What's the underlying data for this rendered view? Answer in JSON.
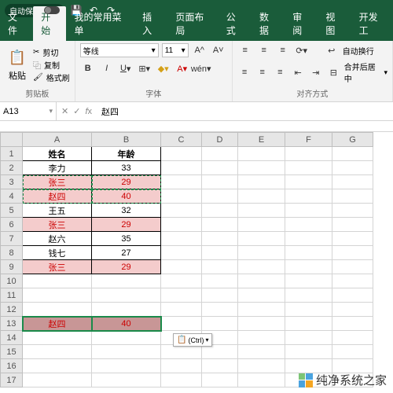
{
  "titlebar": {
    "autosave": "自动保存"
  },
  "tabs": {
    "file": "文件",
    "home": "开始",
    "custom": "我的常用菜单",
    "insert": "插入",
    "layout": "页面布局",
    "formula": "公式",
    "data": "数据",
    "review": "审阅",
    "view": "视图",
    "dev": "开发工"
  },
  "ribbon": {
    "clipboard": {
      "label": "剪贴板",
      "paste": "粘贴",
      "cut": "剪切",
      "copy": "复制",
      "painter": "格式刷"
    },
    "font": {
      "label": "字体",
      "name": "等线",
      "size": "11"
    },
    "align": {
      "label": "对齐方式",
      "wrap": "自动换行",
      "merge": "合并后居中"
    }
  },
  "namebox": {
    "ref": "A13",
    "value": "赵四"
  },
  "grid": {
    "cols": [
      "A",
      "B",
      "C",
      "D",
      "E",
      "F",
      "G"
    ],
    "headers": [
      "姓名",
      "年龄"
    ],
    "rows": [
      {
        "n": "李力",
        "a": "33",
        "pink": false
      },
      {
        "n": "张三",
        "a": "29",
        "pink": true,
        "dash": true
      },
      {
        "n": "赵四",
        "a": "40",
        "pink": true,
        "dash": true
      },
      {
        "n": "王五",
        "a": "32",
        "pink": false
      },
      {
        "n": "张三",
        "a": "29",
        "pink": true
      },
      {
        "n": "赵六",
        "a": "35",
        "pink": false
      },
      {
        "n": "钱七",
        "a": "27",
        "pink": false
      },
      {
        "n": "张三",
        "a": "29",
        "pink": true
      }
    ],
    "pasted": {
      "row": 13,
      "n": "赵四",
      "a": "40"
    },
    "ctrl": "(Ctrl)"
  },
  "watermark": "纯净系统之家"
}
